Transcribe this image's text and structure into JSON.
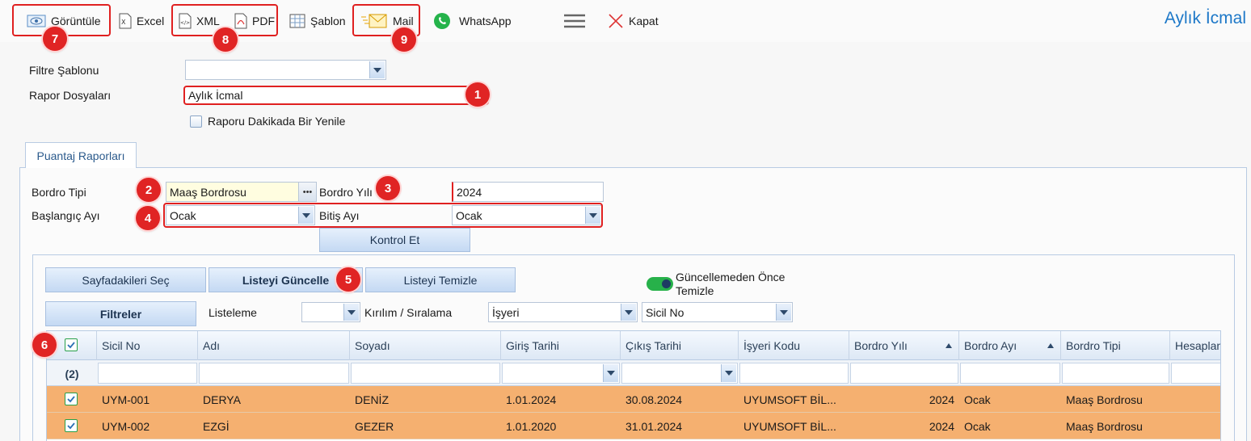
{
  "toolbar": {
    "view": "Görüntüle",
    "excel": "Excel",
    "xml": "XML",
    "pdf": "PDF",
    "template": "Şablon",
    "mail": "Mail",
    "whatsapp": "WhatsApp",
    "close": "Kapat",
    "title": "Aylık İcmal"
  },
  "form": {
    "filter_template_label": "Filtre Şablonu",
    "filter_template_value": "",
    "report_files_label": "Rapor Dosyaları",
    "report_files_value": "Aylık İcmal",
    "refresh_label": "Raporu Dakikada Bir Yenile"
  },
  "tab": {
    "label": "Puantaj Raporları"
  },
  "payroll": {
    "type_label": "Bordro Tipi",
    "type_value": "Maaş Bordrosu",
    "year_label": "Bordro Yılı",
    "year_value": "2024",
    "start_month_label": "Başlangıç Ayı",
    "start_month_value": "Ocak",
    "end_month_label": "Bitiş Ayı",
    "end_month_value": "Ocak",
    "check_button": "Kontrol Et"
  },
  "list": {
    "select_page": "Sayfadakileri Seç",
    "update_list": "Listeyi Güncelle",
    "clear_list": "Listeyi Temizle",
    "clear_before_update": "Güncellemeden Önce Temizle",
    "filters": "Filtreler",
    "listing_label": "Listeleme",
    "listing_value": "",
    "breakdown_label": "Kırılım / Sıralama",
    "breakdown_value_1": "İşyeri",
    "breakdown_value_2": "Sicil No"
  },
  "grid": {
    "count": "(2)",
    "columns": [
      "Sicil No",
      "Adı",
      "Soyadı",
      "Giriş Tarihi",
      "Çıkış Tarihi",
      "İşyeri Kodu",
      "Bordro Yılı",
      "Bordro Ayı",
      "Bordro Tipi",
      "Hesaplan"
    ],
    "rows": [
      [
        "UYM-001",
        "DERYA",
        "DENİZ",
        "1.01.2024",
        "30.08.2024",
        "UYUMSOFT BİL...",
        "2024",
        "Ocak",
        "Maaş Bordrosu",
        ""
      ],
      [
        "UYM-002",
        "EZGİ",
        "GEZER",
        "1.01.2020",
        "31.01.2024",
        "UYUMSOFT BİL...",
        "2024",
        "Ocak",
        "Maaş Bordrosu",
        ""
      ]
    ]
  },
  "badges": [
    "1",
    "2",
    "3",
    "4",
    "5",
    "6",
    "7",
    "8",
    "9"
  ],
  "colors": {
    "accent": "#1d78c8",
    "highlight_row": "#f5b070",
    "annotation": "#e02424",
    "toggle_on": "#27b14a"
  }
}
